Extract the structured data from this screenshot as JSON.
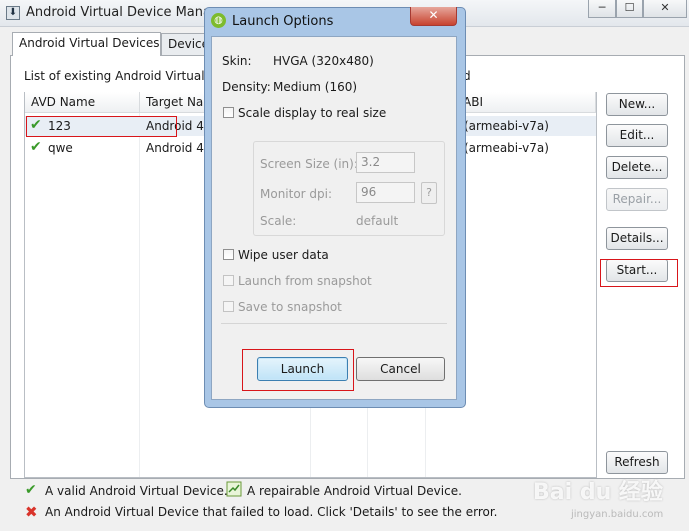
{
  "window": {
    "title": "Android Virtual Device Manage",
    "minimize": "─",
    "maximize": "☐",
    "close": "✕"
  },
  "tabs": [
    {
      "label": "Android Virtual Devices",
      "selected": true
    },
    {
      "label": "Device"
    }
  ],
  "list": {
    "caption": "List of existing Android Virtual",
    "caption_tail": "d",
    "columns": [
      "AVD Name",
      "Target Na",
      "ABI"
    ],
    "rows": [
      {
        "name": "123",
        "target": "Android 4",
        "abi": "(armeabi-v7a)",
        "status": "valid"
      },
      {
        "name": "qwe",
        "target": "Android 4",
        "abi": "(armeabi-v7a)",
        "status": "valid"
      }
    ]
  },
  "buttons": {
    "new": "New...",
    "edit": "Edit...",
    "delete": "Delete...",
    "repair": "Repair...",
    "details": "Details...",
    "start": "Start...",
    "refresh": "Refresh"
  },
  "legend": {
    "valid": "A valid Android Virtual Device.",
    "repairable": "A repairable Android Virtual Device.",
    "failed": "An Android Virtual Device that failed to load. Click 'Details' to see the error."
  },
  "dialog": {
    "title": "Launch Options",
    "skin_label": "Skin:",
    "skin_value": "HVGA (320x480)",
    "density_label": "Density:",
    "density_value": "Medium (160)",
    "scale_checkbox": "Scale display to real size",
    "screen_size_label": "Screen Size (in):",
    "screen_size_value": "3.2",
    "monitor_dpi_label": "Monitor dpi:",
    "monitor_dpi_value": "96",
    "help": "?",
    "scale_label": "Scale:",
    "scale_value": "default",
    "wipe_checkbox": "Wipe user data",
    "launch_snapshot_checkbox": "Launch from snapshot",
    "save_snapshot_checkbox": "Save to snapshot",
    "launch_button": "Launch",
    "cancel_button": "Cancel",
    "close": "✕"
  },
  "watermark": {
    "text": "Bai du 经验",
    "sub": "jingyan.baidu.com"
  },
  "colors": {
    "highlight": "#d8151a",
    "valid_check": "#3a9a2a",
    "failed_x": "#d9342b"
  }
}
